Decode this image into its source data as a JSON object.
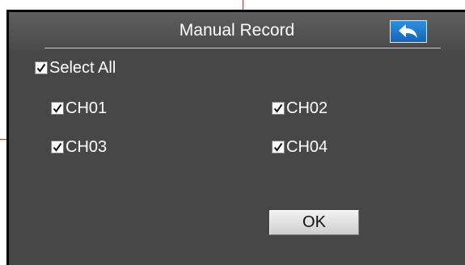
{
  "dialog": {
    "title": "Manual Record",
    "back_icon": "back-arrow-icon",
    "accent_color": "#1a6fc4"
  },
  "select_all": {
    "label": "Select All",
    "checked": true
  },
  "channels": [
    {
      "label": "CH01",
      "checked": true
    },
    {
      "label": "CH02",
      "checked": true
    },
    {
      "label": "CH03",
      "checked": true
    },
    {
      "label": "CH04",
      "checked": true
    }
  ],
  "ok_label": "OK"
}
